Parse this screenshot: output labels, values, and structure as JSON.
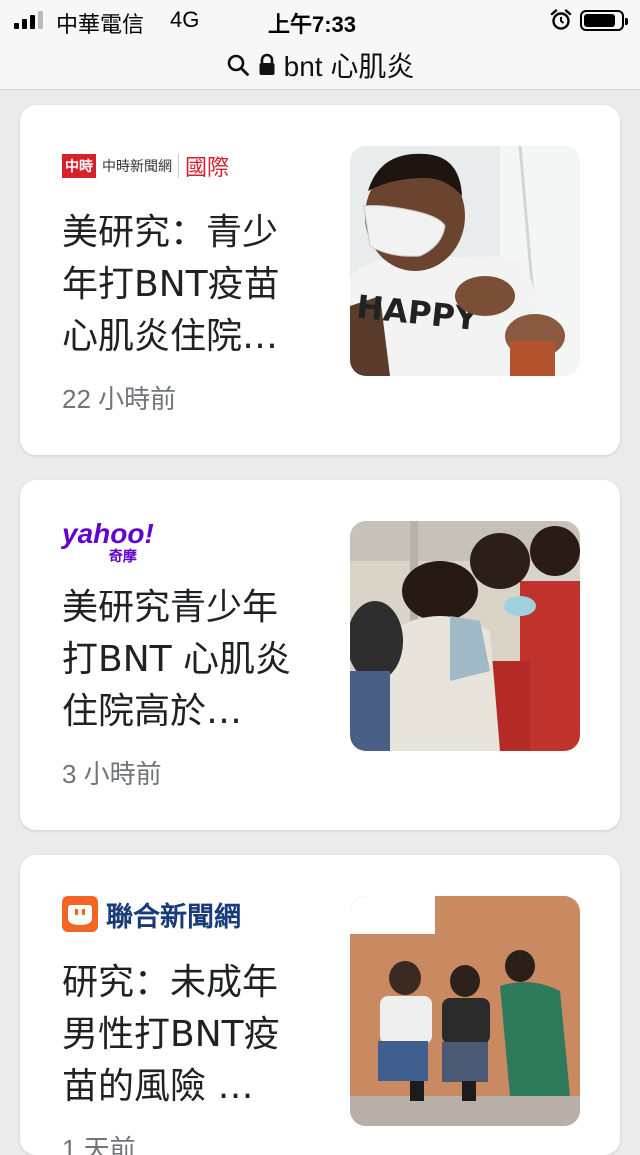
{
  "status_bar": {
    "carrier": "中華電信",
    "network": "4G",
    "time": "上午7:33"
  },
  "url_bar": {
    "query": "bnt 心肌炎"
  },
  "articles": [
    {
      "source": "中時新聞網",
      "source_section": "國際",
      "source_badge": "中時",
      "headline": "美研究：青少年打BNT疫苗心肌炎住院…",
      "time": "22 小時前",
      "thumb_text": "HAPPY"
    },
    {
      "source": "yahoo!",
      "source_sub": "奇摩",
      "headline": "美研究青少年打BNT 心肌炎住院高於…",
      "time": "3 小時前"
    },
    {
      "source": "聯合新聞網",
      "headline": "研究：未成年男性打BNT疫苗的風險 …",
      "time": "1 天前"
    }
  ],
  "colors": {
    "chinatimes_red": "#d6202a",
    "yahoo_purple": "#6001d2",
    "udn_orange": "#f26522",
    "udn_navy": "#1a3b7a"
  }
}
